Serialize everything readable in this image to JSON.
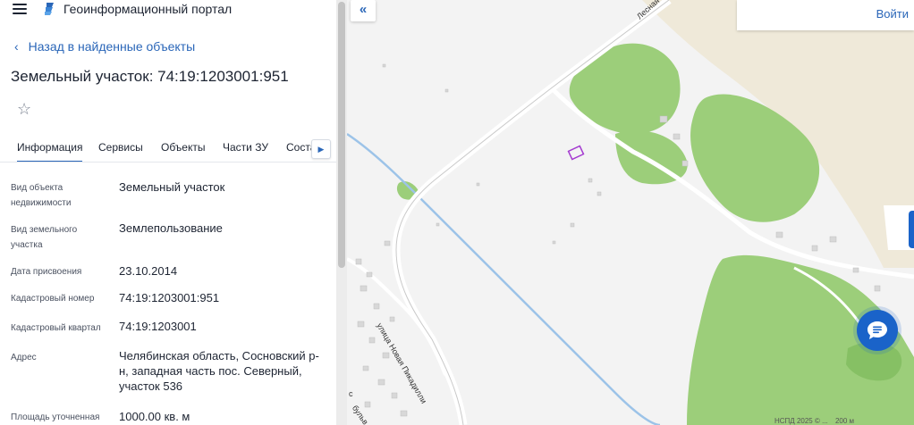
{
  "header": {
    "app_title": "Геоинформационный портал",
    "menu_icon": "hamburger-icon",
    "logo_icon": "portal-logo-icon"
  },
  "nav": {
    "back_label": "Назад в найденные объекты"
  },
  "object": {
    "title": "Земельный участок: 74:19:1203001:951"
  },
  "tabs": [
    {
      "label": "Информация",
      "active": true
    },
    {
      "label": "Сервисы",
      "active": false
    },
    {
      "label": "Объекты",
      "active": false
    },
    {
      "label": "Части ЗУ",
      "active": false
    },
    {
      "label": "Соста",
      "active": false
    }
  ],
  "attributes": [
    {
      "label": "Вид объекта недвижимости",
      "value": "Земельный участок"
    },
    {
      "label": "Вид земельного участка",
      "value": "Землепользование"
    },
    {
      "label": "Дата присвоения",
      "value": "23.10.2014"
    },
    {
      "label": "Кадастровый номер",
      "value": "74:19:1203001:951"
    },
    {
      "label": "Кадастровый квартал",
      "value": "74:19:1203001"
    },
    {
      "label": "Адрес",
      "value": "Челябинская область, Сосновский р-н, западная часть пос. Северный, участок 536"
    },
    {
      "label": "Площадь уточненная",
      "value": "1000.00 кв. м"
    }
  ],
  "map": {
    "login_label": "Войти",
    "copyright": "НСПД 2025 © ...",
    "scale_label": "200 м",
    "street_1": "Лесная",
    "street_2": "улица Новая Пикадилли",
    "street_3": "бульв",
    "street_4": "с",
    "colors": {
      "forest": "#9cce7a",
      "forest_dark": "#86c064",
      "field": "#efe9d9",
      "water": "#9cc3e8",
      "road": "#ffffff",
      "parcel": "#a43bd0",
      "accent": "#1a63c9"
    }
  }
}
